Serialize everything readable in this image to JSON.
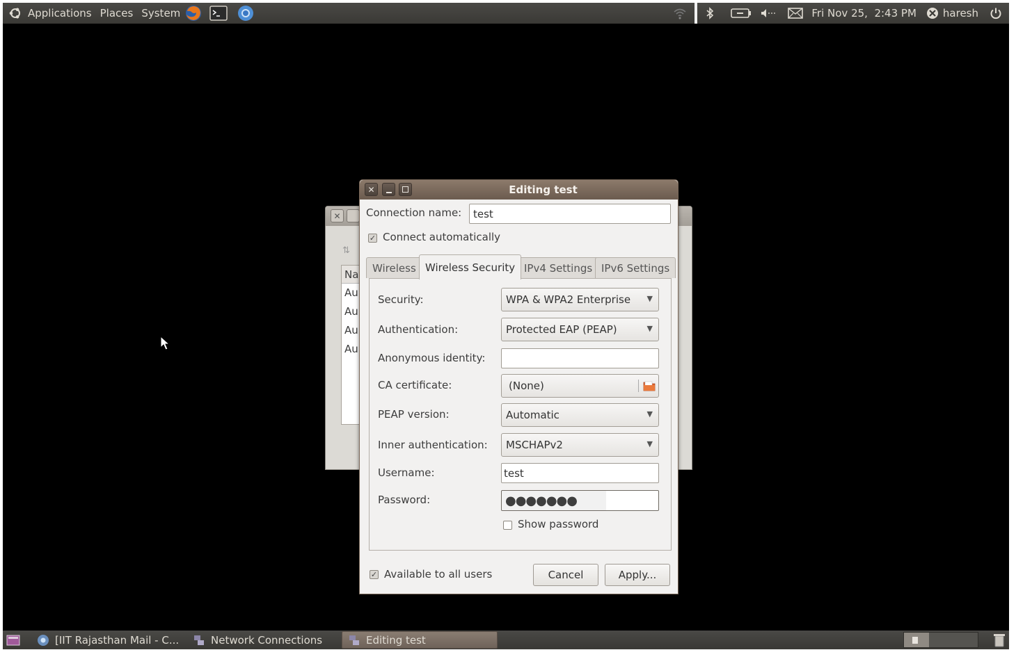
{
  "top_panel": {
    "menus": [
      "Applications",
      "Places",
      "System"
    ],
    "clock": "Fri Nov 25,  2:43 PM",
    "user": "haresh"
  },
  "dialog": {
    "title": "Editing test",
    "connection_name_label": "Connection name:",
    "connection_name_value": "test",
    "connect_auto_label": "Connect automatically",
    "tabs": [
      "Wireless",
      "Wireless Security",
      "IPv4 Settings",
      "IPv6 Settings"
    ],
    "fields": {
      "security_label": "Security:",
      "security_value": "WPA & WPA2 Enterprise",
      "auth_label": "Authentication:",
      "auth_value": "Protected EAP (PEAP)",
      "anon_label": "Anonymous identity:",
      "anon_value": "",
      "ca_label": "CA certificate:",
      "ca_value": "(None)",
      "peap_label": "PEAP version:",
      "peap_value": "Automatic",
      "inner_label": "Inner authentication:",
      "inner_value": "MSCHAPv2",
      "username_label": "Username:",
      "username_value": "test",
      "password_label": "Password:",
      "password_value": "●●●●●●●",
      "show_password_label": "Show password"
    },
    "available_label": "Available to all users",
    "cancel_label": "Cancel",
    "apply_label": "Apply..."
  },
  "back_window": {
    "list_header": "Na",
    "list_rows": [
      "Au",
      "Au",
      "Au",
      "Au"
    ]
  },
  "bottom_panel": {
    "tasks": [
      "[IIT Rajasthan Mail - C...",
      "Network Connections",
      "Editing test"
    ]
  },
  "colors": {
    "desktop": "#000000",
    "panel": "#3c3b37",
    "titlebar": "#7a6a5c",
    "dialog_bg": "#f2f1f0"
  }
}
